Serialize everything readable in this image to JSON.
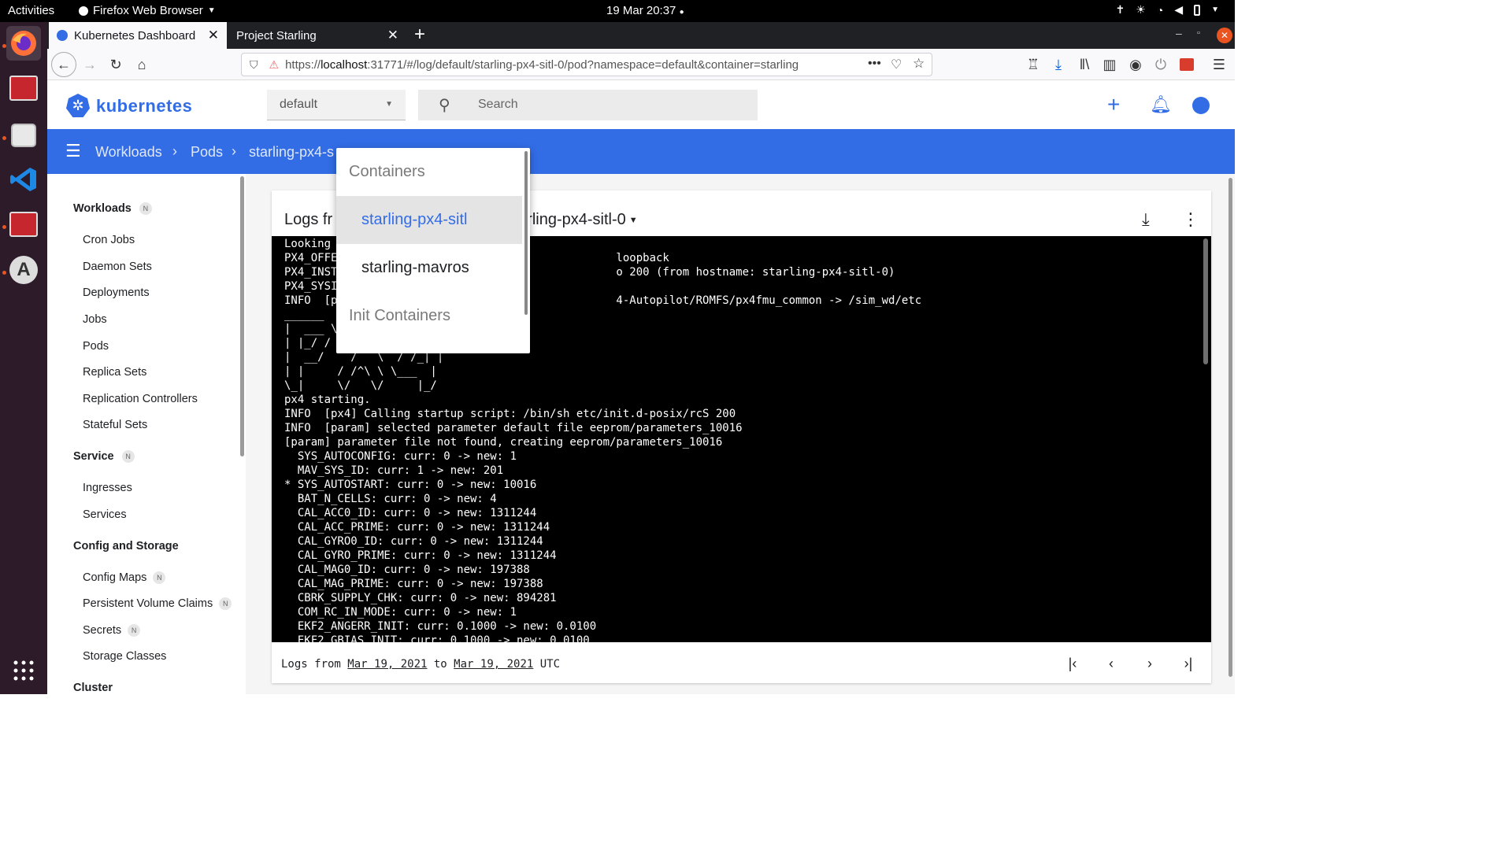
{
  "topbar": {
    "activities": "Activities",
    "app_name": "Firefox Web Browser",
    "datetime": "19 Mar  20:37"
  },
  "tabs": [
    {
      "label": "Kubernetes Dashboard",
      "active": true
    },
    {
      "label": "Project Starling",
      "active": false
    }
  ],
  "urlbar": {
    "url_prefix": "https://",
    "url_host": "localhost",
    "url_rest": ":31771/#/log/default/starling-px4-sitl-0/pod?namespace=default&container=starling"
  },
  "header": {
    "logo_text": "kubernetes",
    "namespace": "default",
    "search_placeholder": "Search"
  },
  "breadcrumb": [
    "Workloads",
    "Pods",
    "starling-px4-s"
  ],
  "sidebar": {
    "sections": [
      {
        "label": "Workloads",
        "badge": "N"
      },
      {
        "label": "Service",
        "badge": "N"
      },
      {
        "label": "Config and Storage",
        "badge": ""
      },
      {
        "label": "Cluster",
        "badge": ""
      }
    ],
    "workload_items": [
      "Cron Jobs",
      "Daemon Sets",
      "Deployments",
      "Jobs",
      "Pods",
      "Replica Sets",
      "Replication Controllers",
      "Stateful Sets"
    ],
    "service_items": [
      "Ingresses",
      "Services"
    ],
    "config_items": [
      {
        "label": "Config Maps",
        "badge": "N"
      },
      {
        "label": "Persistent Volume Claims",
        "badge": "N"
      },
      {
        "label": "Secrets",
        "badge": "N"
      },
      {
        "label": "Storage Classes",
        "badge": ""
      }
    ]
  },
  "card": {
    "title_prefix": "Logs fr",
    "title_suffix": "rling-px4-sitl-0"
  },
  "logs": [
    "Looking",
    "PX4_OFFE                                          loopback",
    "PX4_INST                                          o 200 (from hostname: starling-px4-sitl-0)",
    "PX4_SYSI",
    "INFO  [p                                          4-Autopilot/ROMFS/px4fmu_common -> /sim_wd/etc",
    "______",
    "|  ___ \\",
    "| |_/ /",
    "|  __/    /   \\  / /_| |",
    "| |     / /^\\ \\ \\___  |",
    "\\_|     \\/   \\/     |_/",
    "px4 starting.",
    "INFO  [px4] Calling startup script: /bin/sh etc/init.d-posix/rcS 200",
    "INFO  [param] selected parameter default file eeprom/parameters_10016",
    "[param] parameter file not found, creating eeprom/parameters_10016",
    "  SYS_AUTOCONFIG: curr: 0 -> new: 1",
    "  MAV_SYS_ID: curr: 1 -> new: 201",
    "* SYS_AUTOSTART: curr: 0 -> new: 10016",
    "  BAT_N_CELLS: curr: 0 -> new: 4",
    "  CAL_ACC0_ID: curr: 0 -> new: 1311244",
    "  CAL_ACC_PRIME: curr: 0 -> new: 1311244",
    "  CAL_GYRO0_ID: curr: 0 -> new: 1311244",
    "  CAL_GYRO_PRIME: curr: 0 -> new: 1311244",
    "  CAL_MAG0_ID: curr: 0 -> new: 197388",
    "  CAL_MAG_PRIME: curr: 0 -> new: 197388",
    "  CBRK_SUPPLY_CHK: curr: 0 -> new: 894281",
    "  COM_RC_IN_MODE: curr: 0 -> new: 1",
    "  EKF2_ANGERR_INIT: curr: 0.1000 -> new: 0.0100",
    "  EKF2_GBIAS_INIT: curr: 0.1000 -> new: 0.0100"
  ],
  "footer": {
    "text1": "Logs from ",
    "from_date": "Mar 19, 2021",
    "text2": " to ",
    "to_date": "Mar 19, 2021",
    "text3": " UTC",
    "first_icon": "K<",
    "prev_icon": "<",
    "next_icon": ">",
    "last_icon": ">I"
  },
  "menu": {
    "header_containers": "Containers",
    "items": [
      "starling-px4-sitl",
      "starling-mavros"
    ],
    "selected_index": 0,
    "header_init": "Init Containers"
  },
  "colors": {
    "k8s_blue": "#326de6",
    "dock_bg": "#2d1b2a",
    "log_bg": "#000000"
  }
}
